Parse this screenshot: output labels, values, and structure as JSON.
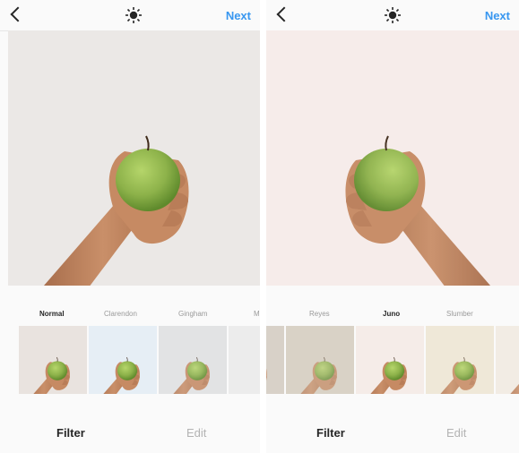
{
  "left_screen": {
    "next_label": "Next",
    "filters": [
      {
        "name": "Normal",
        "selected": true
      },
      {
        "name": "Clarendon",
        "selected": false
      },
      {
        "name": "Gingham",
        "selected": false
      },
      {
        "name": "M",
        "selected": false
      }
    ],
    "tabs": {
      "filter": "Filter",
      "edit": "Edit"
    },
    "active_tab": "Filter",
    "thumbnail_tints": [
      "#e9e3df",
      "#e6eef5",
      "#e2e3e4",
      "#ececec"
    ],
    "photo_background": "#ebe8e6"
  },
  "right_screen": {
    "next_label": "Next",
    "filters": [
      {
        "name": "Reyes",
        "selected": false
      },
      {
        "name": "Juno",
        "selected": true
      },
      {
        "name": "Slumber",
        "selected": false
      }
    ],
    "tabs": {
      "filter": "Filter",
      "edit": "Edit"
    },
    "active_tab": "Filter",
    "thumbnail_tints": [
      "#d8d1c8",
      "#d9d2c6",
      "#f5ece8",
      "#efe8d8",
      "#f2ece4"
    ],
    "photo_background": "#f6ecea"
  },
  "icons": {
    "back": "chevron-left-icon",
    "lux": "sun-adjust-icon"
  },
  "colors": {
    "accent": "#3897f0",
    "text": "#262626",
    "muted": "#9a9a9a",
    "apple": "#8db24a"
  }
}
